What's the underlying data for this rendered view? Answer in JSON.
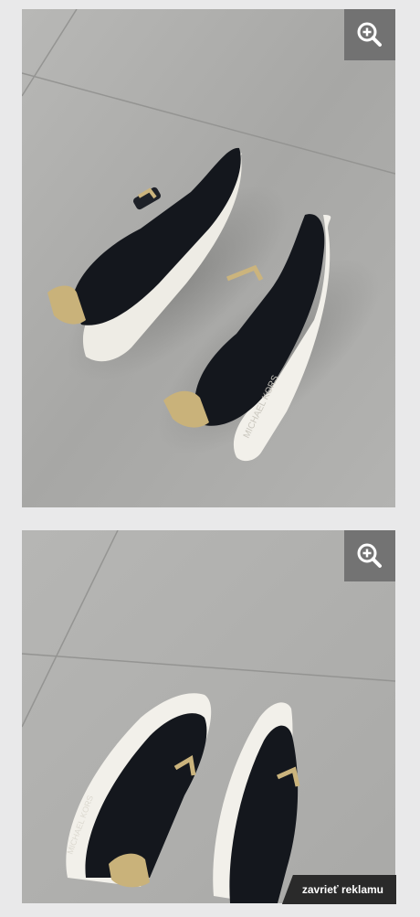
{
  "gallery": {
    "images": [
      {
        "alt": "",
        "zoom_icon": "zoom-in-icon",
        "brand_text": "MICHAEL KORS"
      },
      {
        "alt": "",
        "zoom_icon": "zoom-in-icon",
        "brand_text": "MICHAEL KORS"
      }
    ]
  },
  "ad_bar": {
    "close_label": "zavrieť reklamu"
  },
  "colors": {
    "page_background": "#e9e9ea",
    "tile": "#a9a9a8",
    "grout": "#8e8e8d",
    "shoe_upper": "#14171d",
    "sole": "#f2f0ea",
    "gold_heel": "#c9b27a",
    "zoom_button_bg": "#6e6e6e",
    "ad_bar_bg": "#2a2a2a"
  }
}
